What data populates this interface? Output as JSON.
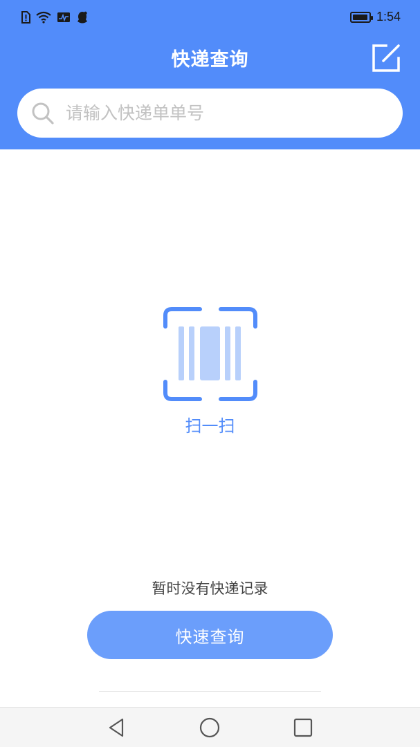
{
  "status_bar": {
    "time": "1:54",
    "battery_level": 0.95,
    "icons": [
      "sim-alert-icon",
      "wifi-icon",
      "activity-monitor-icon",
      "qq-penguin-icon"
    ]
  },
  "header": {
    "title": "快递查询",
    "edit_icon": "edit-icon"
  },
  "search": {
    "placeholder": "请输入快递单单号",
    "value": "",
    "icon": "search-icon"
  },
  "scan": {
    "label": "扫一扫",
    "icon": "barcode-scan-icon"
  },
  "main": {
    "empty_text": "暂时没有快递记录",
    "query_button_label": "快速查询"
  },
  "nav": {
    "icons": [
      "back-icon",
      "home-icon",
      "recents-icon"
    ]
  },
  "colors": {
    "primary": "#528cfa",
    "button": "#6b9efb",
    "scan_light": "#b8d0fb"
  }
}
